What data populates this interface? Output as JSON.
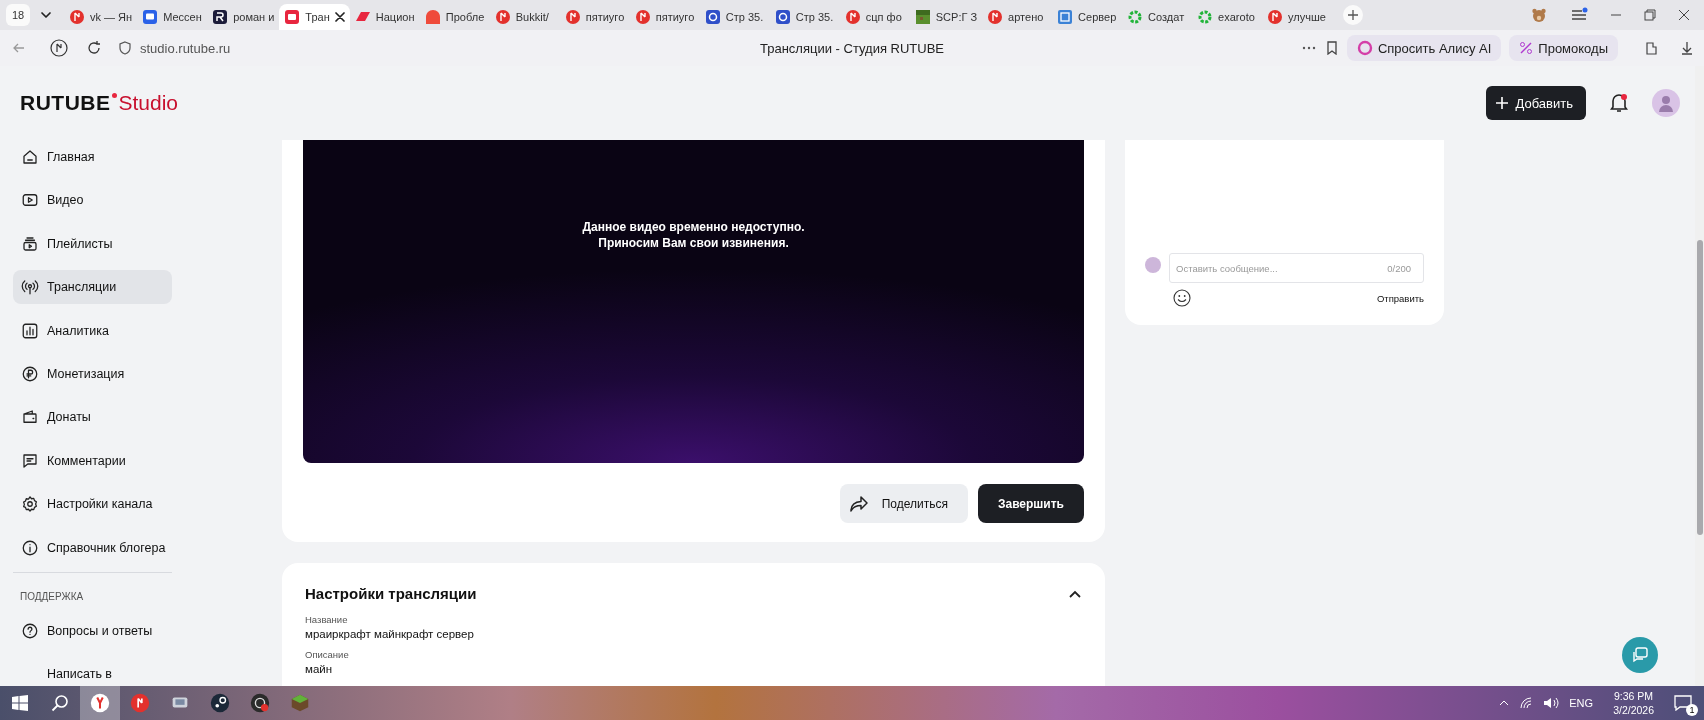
{
  "browser": {
    "tab_count": "18",
    "tabs": [
      {
        "label": "vk — Ян",
        "selected": false
      },
      {
        "label": "Мессен",
        "selected": false
      },
      {
        "label": "роман и",
        "selected": false
      },
      {
        "label": "Тран",
        "selected": true
      },
      {
        "label": "Национ",
        "selected": false
      },
      {
        "label": "Пробле",
        "selected": false
      },
      {
        "label": "Bukkit/",
        "selected": false
      },
      {
        "label": "пятиуго",
        "selected": false
      },
      {
        "label": "пятиуго",
        "selected": false
      },
      {
        "label": "Стр 35.",
        "selected": false
      },
      {
        "label": "Стр 35.",
        "selected": false
      },
      {
        "label": "сцп фо",
        "selected": false
      },
      {
        "label": "SCP:Г З",
        "selected": false
      },
      {
        "label": "артено",
        "selected": false
      },
      {
        "label": "Сервер",
        "selected": false
      },
      {
        "label": "Создат",
        "selected": false
      },
      {
        "label": "exaroto",
        "selected": false
      },
      {
        "label": "улучше",
        "selected": false
      }
    ],
    "url": "studio.rutube.ru",
    "page_title": "Трансляции - Студия RUTUBE",
    "ask_alice": "Спросить Алису AI",
    "promo": "Промокоды"
  },
  "header": {
    "logo": "RUTUBE",
    "logo_suffix": "Studio",
    "add_button": "Добавить"
  },
  "sidebar": {
    "items": [
      {
        "label": "Главная",
        "selected": false
      },
      {
        "label": "Видео",
        "selected": false
      },
      {
        "label": "Плейлисты",
        "selected": false
      },
      {
        "label": "Трансляции",
        "selected": true
      },
      {
        "label": "Аналитика",
        "selected": false
      },
      {
        "label": "Монетизация",
        "selected": false
      },
      {
        "label": "Донаты",
        "selected": false
      },
      {
        "label": "Комментарии",
        "selected": false
      },
      {
        "label": "Настройки канала",
        "selected": false
      },
      {
        "label": "Справочник блогера",
        "selected": false
      }
    ],
    "support_heading": "ПОДДЕРЖКА",
    "support_items": [
      {
        "label": "Вопросы и ответы"
      },
      {
        "label": "Написать в"
      }
    ]
  },
  "player": {
    "message": [
      "Данное видео временно недоступно.",
      "Приносим Вам свои извинения."
    ],
    "share_button": "Поделиться",
    "finish_button": "Завершить"
  },
  "chat": {
    "placeholder": "Оставить сообщение...",
    "counter": "0/200",
    "send_button": "Отправить"
  },
  "settings": {
    "title": "Настройки трансляции",
    "expanded": true,
    "fields": [
      {
        "label": "Название",
        "value": "мраиркрафт майнкрафт сервер"
      },
      {
        "label": "Описание",
        "value": "майн"
      }
    ]
  },
  "taskbar": {
    "apps": [
      {
        "selected": true
      },
      {
        "selected": false
      },
      {
        "selected": false
      },
      {
        "selected": false
      },
      {
        "selected": false
      },
      {
        "selected": false
      }
    ],
    "language": "ENG",
    "time": "9:36 PM",
    "date": "3/2/2026",
    "notifications": "1"
  }
}
